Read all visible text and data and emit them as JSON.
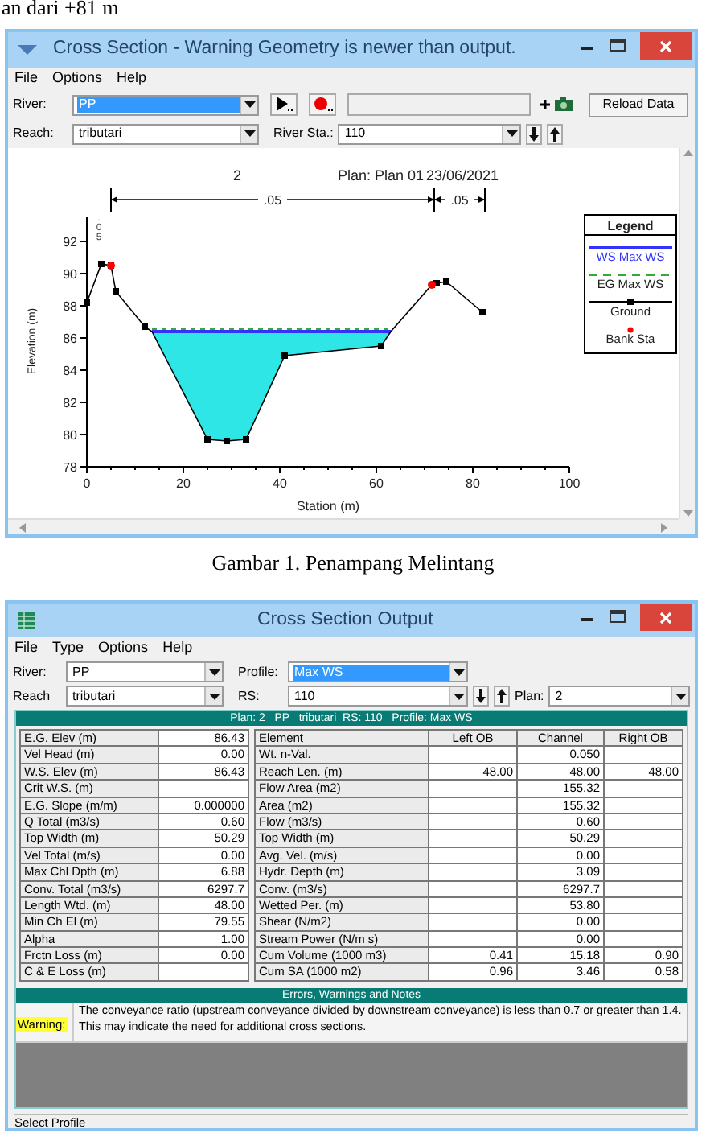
{
  "page_text": "an dari +81 m",
  "cross_section_window": {
    "title": "Cross Section - Warning Geometry is newer than output.",
    "menu": [
      "File",
      "Options",
      "Help"
    ],
    "river": {
      "label": "River:",
      "value": "PP",
      "highlighted": true
    },
    "reach": {
      "label": "Reach:",
      "value": "tributari",
      "highlighted": false
    },
    "river_sta": {
      "label": "River Sta.:",
      "value": "110",
      "highlighted": false
    },
    "reload_button": "Reload Data",
    "plot_header": [
      "2",
      "Plan: Plan 01",
      "23/06/2021"
    ],
    "chart_data": {
      "type": "line",
      "xlabel": "Station (m)",
      "ylabel": "Elevation (m)",
      "x": [
        0,
        3,
        5,
        6,
        12,
        13.5,
        25,
        29,
        33,
        41,
        61,
        63,
        71.5,
        72.5,
        74.5,
        82
      ],
      "series": [
        {
          "name": "WS Max WS",
          "line_style": "solid",
          "marker": "none",
          "color": "#3333ff",
          "values": [
            null,
            null,
            null,
            null,
            null,
            86.4,
            86.4,
            86.4,
            86.4,
            86.4,
            86.4,
            86.4,
            null,
            null,
            null,
            null
          ]
        },
        {
          "name": "EG Max WS",
          "line_style": "dashed",
          "marker": "none",
          "color": "#33aa33",
          "values": [
            null,
            null,
            null,
            null,
            null,
            86.4,
            86.4,
            86.4,
            86.4,
            86.4,
            86.4,
            86.4,
            null,
            null,
            null,
            null
          ]
        },
        {
          "name": "Ground",
          "line_style": "solid",
          "marker": "square",
          "color": "#000000",
          "values": [
            88.2,
            90.6,
            90.5,
            88.9,
            86.7,
            86.4,
            79.7,
            79.6,
            79.7,
            84.9,
            85.5,
            86.4,
            89.3,
            89.4,
            89.5,
            87.6
          ]
        },
        {
          "name": "Bank Sta",
          "type": "scatter",
          "marker": "circle",
          "color": "#ff0000",
          "values": [
            null,
            null,
            90.5,
            null,
            null,
            null,
            null,
            null,
            null,
            null,
            null,
            null,
            89.3,
            null,
            null,
            null
          ]
        }
      ],
      "legend": {
        "title": "Legend"
      },
      "xlim": [
        0,
        100
      ],
      "ylim": [
        78,
        93.5
      ],
      "xticks": [
        0,
        20,
        40,
        60,
        80,
        100
      ],
      "yticks": [
        78,
        80,
        82,
        84,
        86,
        88,
        90,
        92
      ],
      "annotations": [
        ".05",
        ".05",
        ".05"
      ]
    }
  },
  "caption": "Gambar 1. Penampang Melintang",
  "output_window": {
    "title": "Cross Section Output",
    "menu": [
      "File",
      "Type",
      "Options",
      "Help"
    ],
    "river": {
      "label": "River:",
      "value": "PP",
      "highlighted": false
    },
    "profile": {
      "label": "Profile:",
      "value": "Max WS",
      "highlighted": true
    },
    "reach": {
      "label": "Reach",
      "value": "tributari",
      "highlighted": false
    },
    "rs": {
      "label": "RS:",
      "value": "110",
      "highlighted": false
    },
    "plan": {
      "label": "Plan:",
      "value": "2",
      "highlighted": false
    },
    "header": "Plan: 2   PP   tributari  RS: 110   Profile: Max WS",
    "left_table": [
      {
        "label": "E.G. Elev (m)",
        "value": "86.43"
      },
      {
        "label": "Vel Head (m)",
        "value": "0.00"
      },
      {
        "label": "W.S. Elev (m)",
        "value": "86.43"
      },
      {
        "label": "Crit W.S. (m)"
      },
      {
        "label": "E.G. Slope (m/m)",
        "value": "0.000000"
      },
      {
        "label": "Q Total (m3/s)",
        "value": "0.60"
      },
      {
        "label": "Top Width (m)",
        "value": "50.29"
      },
      {
        "label": "Vel Total (m/s)",
        "value": "0.00"
      },
      {
        "label": "Max Chl Dpth (m)",
        "value": "6.88"
      },
      {
        "label": "Conv. Total (m3/s)",
        "value": "6297.7"
      },
      {
        "label": "Length Wtd. (m)",
        "value": "48.00"
      },
      {
        "label": "Min Ch El (m)",
        "value": "79.55"
      },
      {
        "label": "Alpha",
        "value": "1.00"
      },
      {
        "label": "Frctn Loss (m)",
        "value": "0.00"
      },
      {
        "label": "C & E Loss (m)"
      }
    ],
    "right_columns": [
      "Element",
      "Left OB",
      "Channel",
      "Right OB"
    ],
    "right_table": [
      {
        "element": "Wt. n-Val.",
        "channel": "0.050"
      },
      {
        "element": "Reach Len. (m)",
        "left_ob": "48.00",
        "channel": "48.00",
        "right_ob": "48.00"
      },
      {
        "element": "Flow Area (m2)",
        "channel": "155.32"
      },
      {
        "element": "Area (m2)",
        "channel": "155.32"
      },
      {
        "element": "Flow (m3/s)",
        "channel": "0.60"
      },
      {
        "element": "Top Width (m)",
        "channel": "50.29"
      },
      {
        "element": "Avg. Vel. (m/s)",
        "channel": "0.00"
      },
      {
        "element": "Hydr. Depth (m)",
        "channel": "3.09"
      },
      {
        "element": "Conv. (m3/s)",
        "channel": "6297.7"
      },
      {
        "element": "Wetted Per. (m)",
        "channel": "53.80"
      },
      {
        "element": "Shear (N/m2)",
        "channel": "0.00"
      },
      {
        "element": "Stream Power (N/m s)",
        "channel": "0.00"
      },
      {
        "element": "Cum Volume (1000 m3)",
        "left_ob": "0.41",
        "channel": "15.18",
        "right_ob": "0.90"
      },
      {
        "element": "Cum SA (1000 m2)",
        "left_ob": "0.96",
        "channel": "3.46",
        "right_ob": "0.58"
      }
    ],
    "errors_title": "Errors, Warnings and Notes",
    "messages": [
      {
        "kind": "warning",
        "label": "Warning:",
        "text": "The conveyance ratio (upstream conveyance divided by downstream conveyance) is less than 0.7 or greater than 1.4.  This may indicate the need for additional cross sections."
      }
    ],
    "status": "Select Profile"
  }
}
